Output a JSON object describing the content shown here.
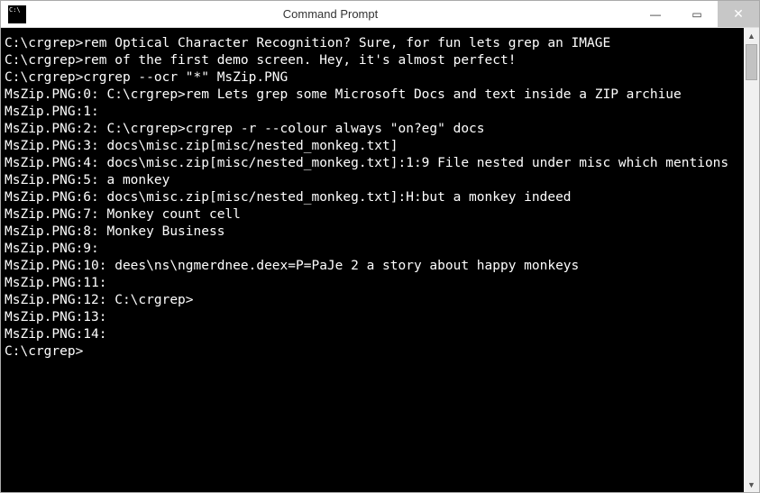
{
  "window": {
    "title": "Command Prompt",
    "controls": {
      "minimize": "—",
      "maximize": "▭",
      "close": "✕"
    }
  },
  "terminal": {
    "lines": [
      "",
      "C:\\crgrep>rem Optical Character Recognition? Sure, for fun lets grep an IMAGE",
      "",
      "C:\\crgrep>rem of the first demo screen. Hey, it's almost perfect!",
      "",
      "C:\\crgrep>crgrep --ocr \"*\" MsZip.PNG",
      "MsZip.PNG:0: C:\\crgrep>rem Lets grep some Microsoft Docs and text inside a ZIP archiue",
      "MsZip.PNG:1:",
      "MsZip.PNG:2: C:\\crgrep>crgrep -r --colour always \"on?eg\" docs",
      "MsZip.PNG:3: docs\\misc.zip[misc/nested_monkeg.txt]",
      "MsZip.PNG:4: docs\\misc.zip[misc/nested_monkeg.txt]:1:9 File nested under misc which mentions",
      "MsZip.PNG:5: a monkey",
      "MsZip.PNG:6: docs\\misc.zip[misc/nested_monkeg.txt]:H:but a monkey indeed",
      "MsZip.PNG:7: Monkey count cell",
      "MsZip.PNG:8: Monkey Business",
      "MsZip.PNG:9:",
      "MsZip.PNG:10: dees\\ns\\ngmerdnee.deex=P=PaJe 2 a story about happy monkeys",
      "MsZip.PNG:11:",
      "MsZip.PNG:12: C:\\crgrep>",
      "MsZip.PNG:13:",
      "MsZip.PNG:14:",
      "",
      "C:\\crgrep>"
    ]
  },
  "scrollbar": {
    "up_arrow": "▲",
    "down_arrow": "▼"
  }
}
